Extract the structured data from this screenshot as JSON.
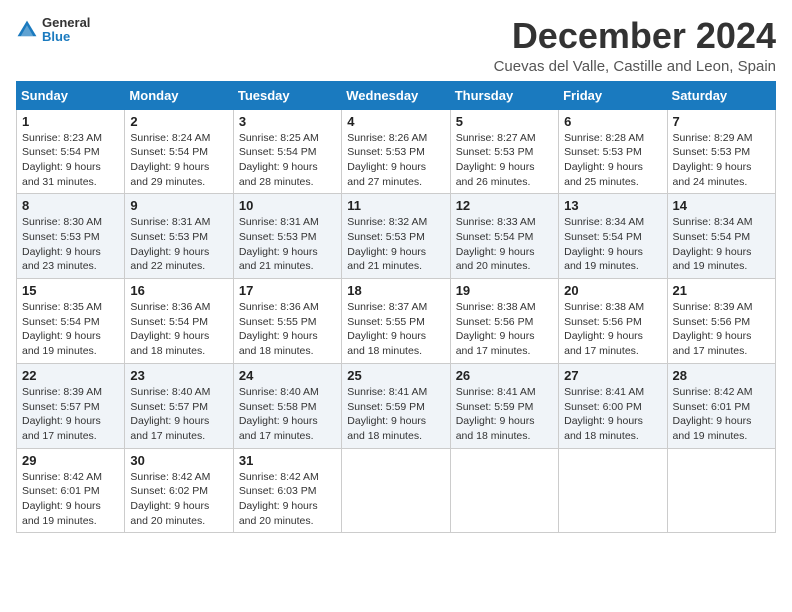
{
  "logo": {
    "line1": "General",
    "line2": "Blue"
  },
  "title": "December 2024",
  "location": "Cuevas del Valle, Castille and Leon, Spain",
  "headers": [
    "Sunday",
    "Monday",
    "Tuesday",
    "Wednesday",
    "Thursday",
    "Friday",
    "Saturday"
  ],
  "weeks": [
    [
      {
        "day": "1",
        "info": "Sunrise: 8:23 AM\nSunset: 5:54 PM\nDaylight: 9 hours\nand 31 minutes."
      },
      {
        "day": "2",
        "info": "Sunrise: 8:24 AM\nSunset: 5:54 PM\nDaylight: 9 hours\nand 29 minutes."
      },
      {
        "day": "3",
        "info": "Sunrise: 8:25 AM\nSunset: 5:54 PM\nDaylight: 9 hours\nand 28 minutes."
      },
      {
        "day": "4",
        "info": "Sunrise: 8:26 AM\nSunset: 5:53 PM\nDaylight: 9 hours\nand 27 minutes."
      },
      {
        "day": "5",
        "info": "Sunrise: 8:27 AM\nSunset: 5:53 PM\nDaylight: 9 hours\nand 26 minutes."
      },
      {
        "day": "6",
        "info": "Sunrise: 8:28 AM\nSunset: 5:53 PM\nDaylight: 9 hours\nand 25 minutes."
      },
      {
        "day": "7",
        "info": "Sunrise: 8:29 AM\nSunset: 5:53 PM\nDaylight: 9 hours\nand 24 minutes."
      }
    ],
    [
      {
        "day": "8",
        "info": "Sunrise: 8:30 AM\nSunset: 5:53 PM\nDaylight: 9 hours\nand 23 minutes."
      },
      {
        "day": "9",
        "info": "Sunrise: 8:31 AM\nSunset: 5:53 PM\nDaylight: 9 hours\nand 22 minutes."
      },
      {
        "day": "10",
        "info": "Sunrise: 8:31 AM\nSunset: 5:53 PM\nDaylight: 9 hours\nand 21 minutes."
      },
      {
        "day": "11",
        "info": "Sunrise: 8:32 AM\nSunset: 5:53 PM\nDaylight: 9 hours\nand 21 minutes."
      },
      {
        "day": "12",
        "info": "Sunrise: 8:33 AM\nSunset: 5:54 PM\nDaylight: 9 hours\nand 20 minutes."
      },
      {
        "day": "13",
        "info": "Sunrise: 8:34 AM\nSunset: 5:54 PM\nDaylight: 9 hours\nand 19 minutes."
      },
      {
        "day": "14",
        "info": "Sunrise: 8:34 AM\nSunset: 5:54 PM\nDaylight: 9 hours\nand 19 minutes."
      }
    ],
    [
      {
        "day": "15",
        "info": "Sunrise: 8:35 AM\nSunset: 5:54 PM\nDaylight: 9 hours\nand 19 minutes."
      },
      {
        "day": "16",
        "info": "Sunrise: 8:36 AM\nSunset: 5:54 PM\nDaylight: 9 hours\nand 18 minutes."
      },
      {
        "day": "17",
        "info": "Sunrise: 8:36 AM\nSunset: 5:55 PM\nDaylight: 9 hours\nand 18 minutes."
      },
      {
        "day": "18",
        "info": "Sunrise: 8:37 AM\nSunset: 5:55 PM\nDaylight: 9 hours\nand 18 minutes."
      },
      {
        "day": "19",
        "info": "Sunrise: 8:38 AM\nSunset: 5:56 PM\nDaylight: 9 hours\nand 17 minutes."
      },
      {
        "day": "20",
        "info": "Sunrise: 8:38 AM\nSunset: 5:56 PM\nDaylight: 9 hours\nand 17 minutes."
      },
      {
        "day": "21",
        "info": "Sunrise: 8:39 AM\nSunset: 5:56 PM\nDaylight: 9 hours\nand 17 minutes."
      }
    ],
    [
      {
        "day": "22",
        "info": "Sunrise: 8:39 AM\nSunset: 5:57 PM\nDaylight: 9 hours\nand 17 minutes."
      },
      {
        "day": "23",
        "info": "Sunrise: 8:40 AM\nSunset: 5:57 PM\nDaylight: 9 hours\nand 17 minutes."
      },
      {
        "day": "24",
        "info": "Sunrise: 8:40 AM\nSunset: 5:58 PM\nDaylight: 9 hours\nand 17 minutes."
      },
      {
        "day": "25",
        "info": "Sunrise: 8:41 AM\nSunset: 5:59 PM\nDaylight: 9 hours\nand 18 minutes."
      },
      {
        "day": "26",
        "info": "Sunrise: 8:41 AM\nSunset: 5:59 PM\nDaylight: 9 hours\nand 18 minutes."
      },
      {
        "day": "27",
        "info": "Sunrise: 8:41 AM\nSunset: 6:00 PM\nDaylight: 9 hours\nand 18 minutes."
      },
      {
        "day": "28",
        "info": "Sunrise: 8:42 AM\nSunset: 6:01 PM\nDaylight: 9 hours\nand 19 minutes."
      }
    ],
    [
      {
        "day": "29",
        "info": "Sunrise: 8:42 AM\nSunset: 6:01 PM\nDaylight: 9 hours\nand 19 minutes."
      },
      {
        "day": "30",
        "info": "Sunrise: 8:42 AM\nSunset: 6:02 PM\nDaylight: 9 hours\nand 20 minutes."
      },
      {
        "day": "31",
        "info": "Sunrise: 8:42 AM\nSunset: 6:03 PM\nDaylight: 9 hours\nand 20 minutes."
      },
      null,
      null,
      null,
      null
    ]
  ]
}
